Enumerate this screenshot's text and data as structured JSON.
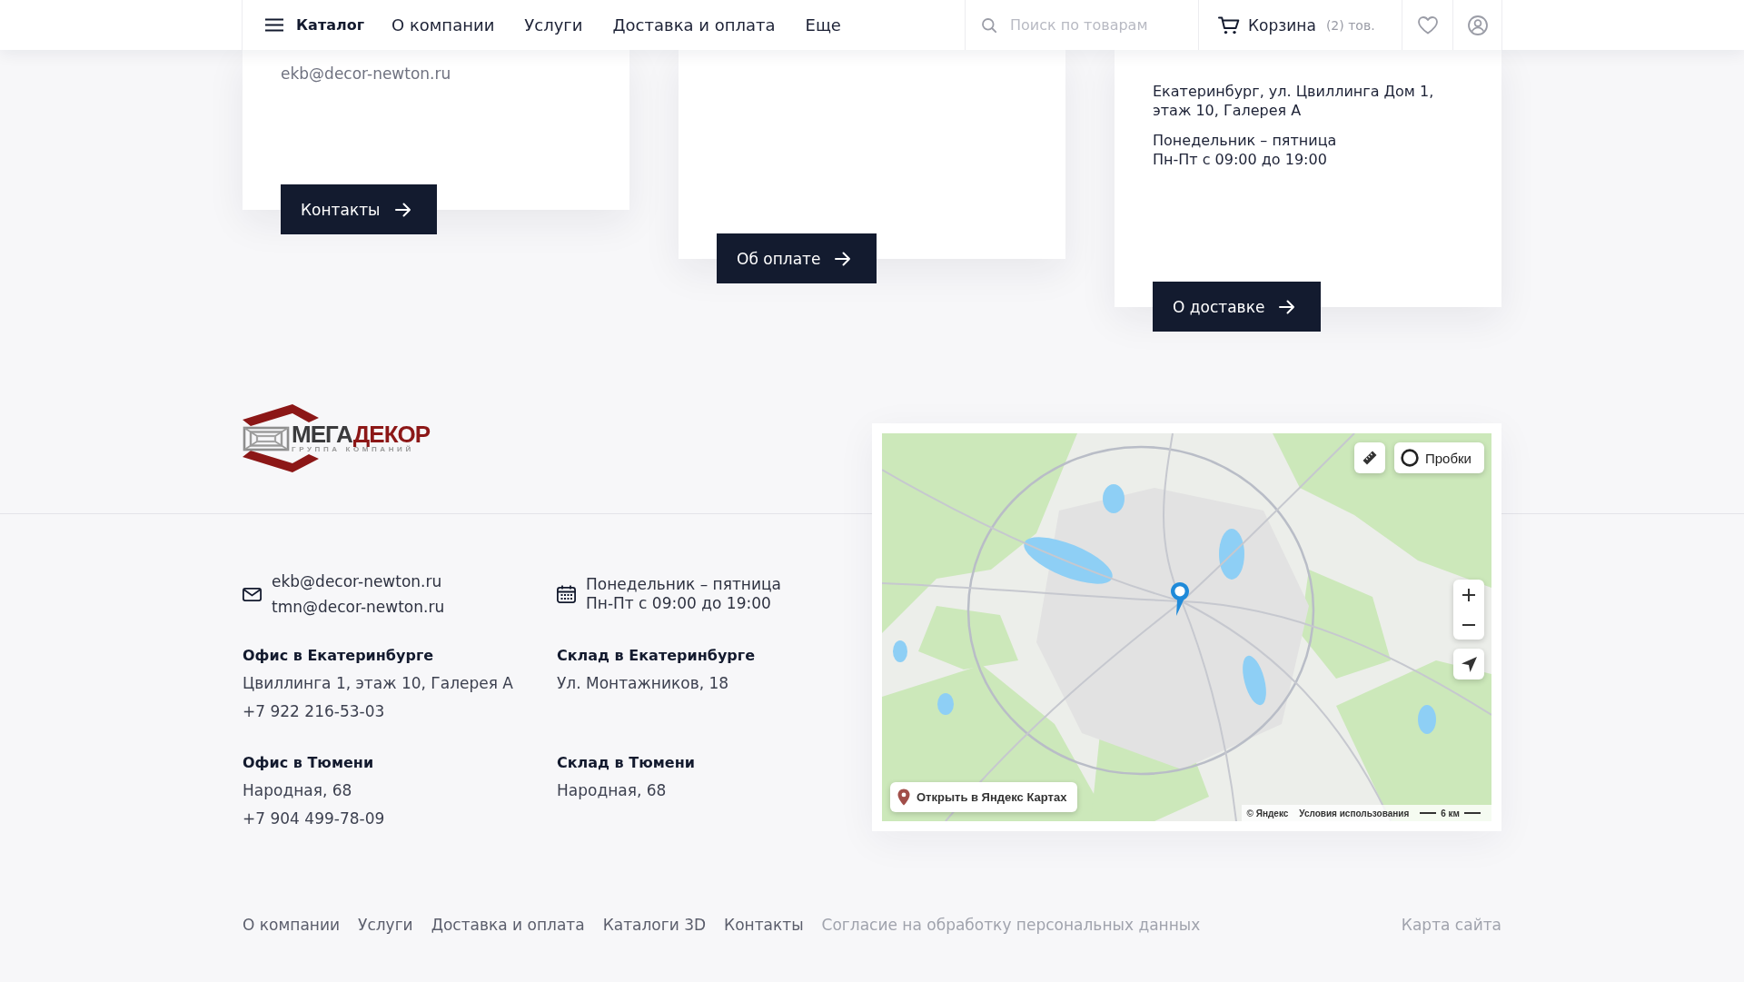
{
  "header": {
    "catalog_label": "Каталог",
    "nav": [
      "О компании",
      "Услуги",
      "Доставка и оплата",
      "Еще"
    ],
    "search": {
      "placeholder": "Поиск по товарам"
    },
    "cart": {
      "label": "Корзина",
      "count": "(2) тов."
    }
  },
  "cards": [
    {
      "lines": [
        {
          "kind": "email",
          "text": "ekb@decor-newton.ru"
        }
      ],
      "button": "Контакты"
    },
    {
      "button": "Об оплате"
    },
    {
      "lines": [
        {
          "kind": "address",
          "text": "Екатеринбург, ул. Цвиллинга Дом 1, этаж 10, Галерея А"
        },
        {
          "kind": "hours",
          "text": "Понедельник – пятница"
        },
        {
          "kind": "hours",
          "text": "Пн-Пт с 09:00 до 19:00"
        }
      ],
      "button": "О доставке"
    }
  ],
  "footer": {
    "logo": {
      "name": "МЕГА",
      "name_accent": "ДЕКОР",
      "tagline": "ГРУППА КОМПАНИЙ"
    },
    "emails": [
      "ekb@decor-newton.ru",
      "tmn@decor-newton.ru"
    ],
    "hours": [
      "Понедельник – пятница",
      "Пн-Пт с 09:00 до 19:00"
    ],
    "locations": [
      {
        "title": "Офис в Екатеринбурге",
        "lines": [
          "Цвиллинга 1, этаж 10, Галерея А",
          "+7 922 216-53-03"
        ]
      },
      {
        "title": "Склад в Екатеринбурге",
        "lines": [
          "Ул. Монтажников, 18"
        ]
      },
      {
        "title": "Офис в Тюмени",
        "lines": [
          "Народная, 68",
          "+7 904 499-78-09"
        ]
      },
      {
        "title": "Склад в Тюмени",
        "lines": [
          "Народная, 68"
        ]
      }
    ]
  },
  "map": {
    "traffic_button": "Пробки",
    "open_button": "Открыть в Яндекс Картах",
    "copyright": "© Яндекс",
    "terms_link": "Условия использования",
    "scale": "6 км"
  },
  "bottom_links": [
    {
      "label": "О компании",
      "kind": "nav"
    },
    {
      "label": "Услуги",
      "kind": "nav"
    },
    {
      "label": "Доставка и оплата",
      "kind": "nav"
    },
    {
      "label": "Каталоги 3D",
      "kind": "nav"
    },
    {
      "label": "Контакты",
      "kind": "nav"
    },
    {
      "label": "Согласие на обработку персональных данных",
      "kind": "legal"
    }
  ],
  "sitemap_link": "Карта сайта"
}
